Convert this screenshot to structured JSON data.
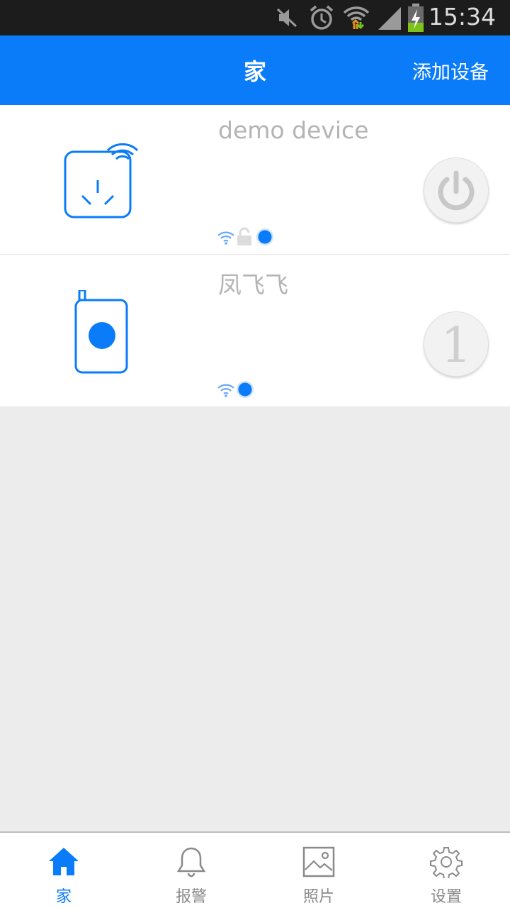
{
  "status_bar": {
    "time": "15:34"
  },
  "header": {
    "title": "家",
    "add_device_label": "添加设备"
  },
  "devices": [
    {
      "name": "demo device",
      "icon": "smart-plug-icon",
      "indicators": [
        "wifi-icon",
        "unlock-icon",
        "online-dot-icon"
      ],
      "action": "power-icon"
    },
    {
      "name": "凤飞飞",
      "icon": "remote-button-icon",
      "indicators": [
        "wifi-icon",
        "online-dot-icon"
      ],
      "action_label": "1"
    }
  ],
  "bottom_nav": [
    {
      "label": "家",
      "icon": "home-icon",
      "active": true
    },
    {
      "label": "报警",
      "icon": "bell-icon",
      "active": false
    },
    {
      "label": "照片",
      "icon": "photo-icon",
      "active": false
    },
    {
      "label": "设置",
      "icon": "gear-icon",
      "active": false
    }
  ],
  "colors": {
    "accent": "#0a7cf9",
    "status_bar": "#1c1c1c",
    "background": "#ececec",
    "device_name": "#b4b4b4"
  }
}
